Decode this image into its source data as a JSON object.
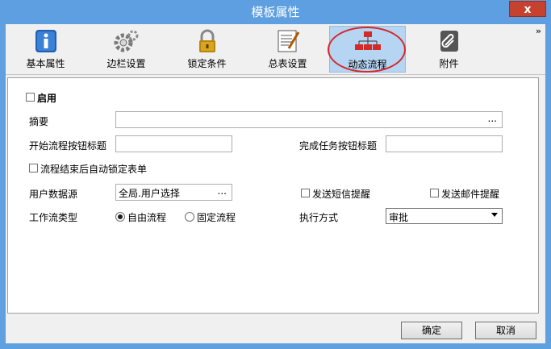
{
  "window": {
    "title": "模板属性",
    "close_label": "x"
  },
  "toolbar": {
    "overflow": "»",
    "items": [
      {
        "label": "基本属性",
        "icon": "info-icon"
      },
      {
        "label": "边栏设置",
        "icon": "gear-icon"
      },
      {
        "label": "锁定条件",
        "icon": "lock-icon"
      },
      {
        "label": "总表设置",
        "icon": "edit-document-icon"
      },
      {
        "label": "动态流程",
        "icon": "flowchart-icon",
        "active": true
      },
      {
        "label": "附件",
        "icon": "paperclip-icon"
      }
    ]
  },
  "form": {
    "enable_label": "启用",
    "summary_label": "摘要",
    "summary_value": "",
    "ellipsis": "...",
    "start_button_title_label": "开始流程按钮标题",
    "complete_button_title_label": "完成任务按钮标题",
    "auto_lock_label": "流程结束后自动锁定表单",
    "user_source_label": "用户数据源",
    "user_source_value": "全局.用户选择",
    "sms_label": "发送短信提醒",
    "email_label": "发送邮件提醒",
    "workflow_type_label": "工作流类型",
    "free_flow_label": "自由流程",
    "fixed_flow_label": "固定流程",
    "exec_mode_label": "执行方式",
    "exec_mode_value": "审批"
  },
  "buttons": {
    "ok": "确定",
    "cancel": "取消"
  },
  "colors": {
    "titlebar": "#5d9fe0",
    "close": "#c7412f",
    "active_tab": "#b6d5f3",
    "highlight_ellipse": "#d42a2a"
  }
}
